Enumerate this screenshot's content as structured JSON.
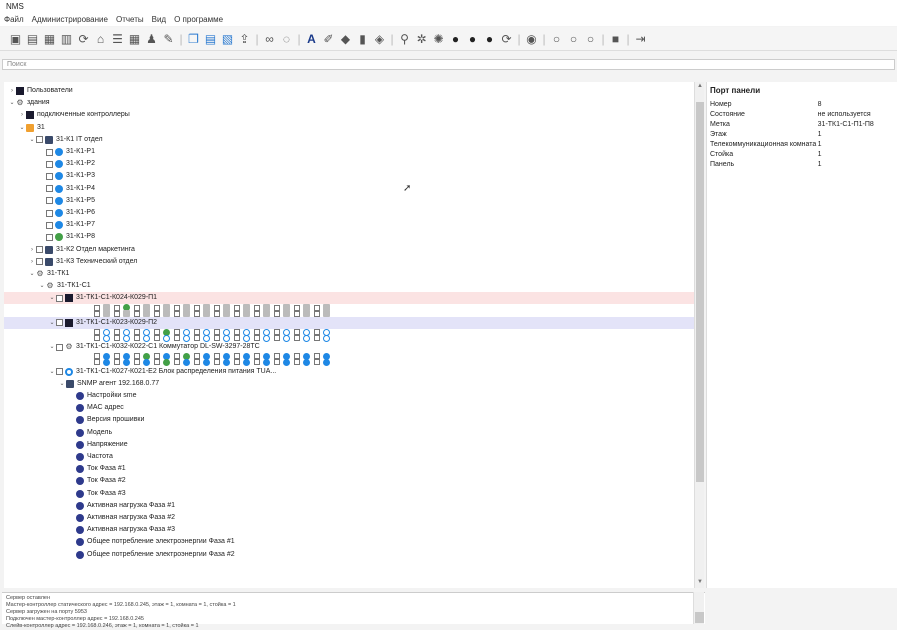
{
  "window": {
    "title": "NMS"
  },
  "menu": [
    "Файл",
    "Администрирование",
    "Отчеты",
    "Вид",
    "О программе"
  ],
  "toolbar": {
    "icons": [
      "save-icon",
      "open-icon",
      "print-icon",
      "scan-icon",
      "refresh-icon",
      "home-icon",
      "list-icon",
      "grid-icon",
      "user-icon",
      "edit-icon",
      "sep",
      "copy-icon",
      "table-icon",
      "report-icon",
      "export-icon",
      "sep",
      "link-icon",
      "chat-icon",
      "sep",
      "text-icon",
      "pen-icon",
      "shield-icon",
      "chart-icon",
      "network-icon",
      "sep",
      "filter-icon",
      "star-icon",
      "settings-icon",
      "circle-icon",
      "circle-icon",
      "circle-icon",
      "refresh-icon",
      "sep",
      "eye-icon",
      "sep",
      "dot-icon",
      "dot-icon",
      "dot-icon",
      "sep",
      "square-icon",
      "sep",
      "exit-icon"
    ]
  },
  "filter": {
    "placeholder": "Поиск"
  },
  "tree": {
    "rows": [
      {
        "indent": 0,
        "toggle": "›",
        "cb": false,
        "icon": "dark",
        "label": "Пользователи"
      },
      {
        "indent": 0,
        "toggle": "⌄",
        "cb": false,
        "icon": "gear",
        "label": "здания"
      },
      {
        "indent": 1,
        "toggle": "›",
        "cb": false,
        "icon": "dark",
        "label": "подключенные контроллеры"
      },
      {
        "indent": 1,
        "toggle": "⌄",
        "cb": false,
        "icon": "folder",
        "label": "31"
      },
      {
        "indent": 2,
        "toggle": "⌄",
        "cb": true,
        "icon": "monitor",
        "label": "31-К1 IT отдел"
      },
      {
        "indent": 3,
        "toggle": "",
        "cb": true,
        "icon": "blue",
        "label": "31-К1-Р1"
      },
      {
        "indent": 3,
        "toggle": "",
        "cb": true,
        "icon": "blue",
        "label": "31-К1-Р2"
      },
      {
        "indent": 3,
        "toggle": "",
        "cb": true,
        "icon": "blue",
        "label": "31-К1-Р3"
      },
      {
        "indent": 3,
        "toggle": "",
        "cb": true,
        "icon": "blue",
        "label": "31-К1-Р4"
      },
      {
        "indent": 3,
        "toggle": "",
        "cb": true,
        "icon": "blue",
        "label": "31-К1-Р5"
      },
      {
        "indent": 3,
        "toggle": "",
        "cb": true,
        "icon": "blue",
        "label": "31-К1-Р6"
      },
      {
        "indent": 3,
        "toggle": "",
        "cb": true,
        "icon": "blue",
        "label": "31-К1-Р7"
      },
      {
        "indent": 3,
        "toggle": "",
        "cb": true,
        "icon": "green",
        "label": "31-К1-Р8"
      },
      {
        "indent": 2,
        "toggle": "›",
        "cb": true,
        "icon": "monitor",
        "label": "31-К2 Отдел маркетинга"
      },
      {
        "indent": 2,
        "toggle": "›",
        "cb": true,
        "icon": "monitor",
        "label": "31-К3 Технический отдел"
      },
      {
        "indent": 2,
        "toggle": "⌄",
        "cb": false,
        "icon": "gear",
        "label": "31-ТК1"
      },
      {
        "indent": 3,
        "toggle": "⌄",
        "cb": false,
        "icon": "gear",
        "label": "31-ТК1-С1"
      },
      {
        "indent": 4,
        "toggle": "⌄",
        "cb": true,
        "icon": "dark",
        "label": "31-ТК1-С1-К024-К029-П1",
        "hl": "red"
      },
      {
        "indent": 4,
        "toggle": "",
        "ports": "grid"
      },
      {
        "indent": 4,
        "toggle": "⌄",
        "cb": true,
        "icon": "dark",
        "label": "31-ТК1-С1-К023-К029-П2",
        "hl": "blue"
      },
      {
        "indent": 4,
        "toggle": "",
        "ports": "ring"
      },
      {
        "indent": 4,
        "toggle": "⌄",
        "cb": true,
        "icon": "gear",
        "label": "31-ТК1-С1-К032-К022-С1 Коммутатор DL-SW-3297-28TC"
      },
      {
        "indent": 4,
        "toggle": "",
        "ports": "blue"
      },
      {
        "indent": 4,
        "toggle": "⌄",
        "cb": true,
        "icon": "ring",
        "label": "31-ТК1-С1-К027-К021-Е2 Блок распределения питания TUA..."
      },
      {
        "indent": 5,
        "toggle": "⌄",
        "cb": false,
        "icon": "monitor",
        "label": "SNMP агент 192.168.0.77"
      },
      {
        "indent": 6,
        "toggle": "",
        "cb": false,
        "icon": "pin",
        "label": "Настройки sme"
      },
      {
        "indent": 6,
        "toggle": "",
        "cb": false,
        "icon": "pin",
        "label": "MAC адрес"
      },
      {
        "indent": 6,
        "toggle": "",
        "cb": false,
        "icon": "pin",
        "label": "Версия прошивки"
      },
      {
        "indent": 6,
        "toggle": "",
        "cb": false,
        "icon": "pin",
        "label": "Модель"
      },
      {
        "indent": 6,
        "toggle": "",
        "cb": false,
        "icon": "pin",
        "label": "Напряжение"
      },
      {
        "indent": 6,
        "toggle": "",
        "cb": false,
        "icon": "pin",
        "label": "Частота"
      },
      {
        "indent": 6,
        "toggle": "",
        "cb": false,
        "icon": "pin",
        "label": "Ток Фаза #1"
      },
      {
        "indent": 6,
        "toggle": "",
        "cb": false,
        "icon": "pin",
        "label": "Ток Фаза #2"
      },
      {
        "indent": 6,
        "toggle": "",
        "cb": false,
        "icon": "pin",
        "label": "Ток Фаза #3"
      },
      {
        "indent": 6,
        "toggle": "",
        "cb": false,
        "icon": "pin",
        "label": "Активная нагрузка Фаза #1"
      },
      {
        "indent": 6,
        "toggle": "",
        "cb": false,
        "icon": "pin",
        "label": "Активная нагрузка Фаза #2"
      },
      {
        "indent": 6,
        "toggle": "",
        "cb": false,
        "icon": "pin",
        "label": "Активная нагрузка Фаза #3"
      },
      {
        "indent": 6,
        "toggle": "",
        "cb": false,
        "icon": "pin",
        "label": "Общее потребление электроэнергии Фаза #1"
      },
      {
        "indent": 6,
        "toggle": "",
        "cb": false,
        "icon": "pin",
        "label": "Общее потребление электроэнергии Фаза #2"
      }
    ]
  },
  "properties": {
    "title": "Порт панели",
    "rows": [
      {
        "k": "Номер",
        "v": "8"
      },
      {
        "k": "Состояние",
        "v": "не используется"
      },
      {
        "k": "Метка",
        "v": "31-ТК1-С1-П1-П8"
      },
      {
        "k": "Этаж",
        "v": "1"
      },
      {
        "k": "Телекоммуникационная комната",
        "v": "1"
      },
      {
        "k": "Стойка",
        "v": "1"
      },
      {
        "k": "Панель",
        "v": "1"
      }
    ]
  },
  "log": {
    "lines": [
      "Сервер оставлен",
      "Мастер-контроллер статического адрес = 192.168.0.245, этаж = 1, комната = 1, стойка = 1",
      "Сервер загружен на порту 5953",
      "Подключен мастер-контроллер адрес = 192.168.0.245",
      "Слейв-контроллер адрес = 192.168.0.246, этаж = 1, комната = 1, стойка = 1"
    ]
  }
}
